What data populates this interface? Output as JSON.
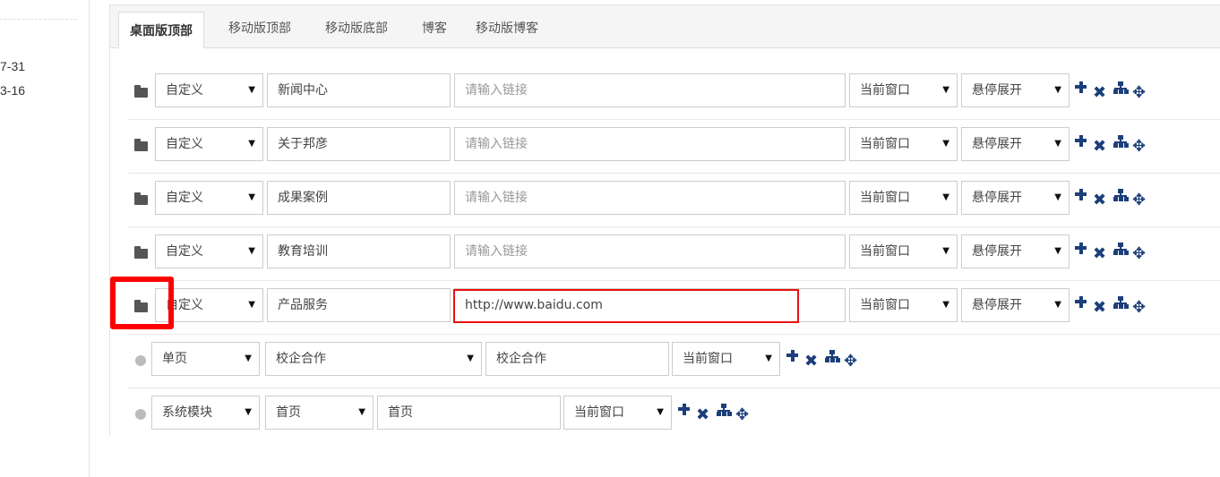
{
  "left_dates": [
    "7-31",
    "3-16"
  ],
  "tabs": [
    "桌面版顶部",
    "移动版顶部",
    "移动版底部",
    "博客",
    "移动版博客"
  ],
  "menu_rows": [
    {
      "type": "自定义",
      "name": "新闻中心",
      "link": "",
      "link_placeholder": "请输入链接",
      "target": "当前窗口",
      "display": "悬停展开"
    },
    {
      "type": "自定义",
      "name": "关于邦彦",
      "link": "",
      "link_placeholder": "请输入链接",
      "target": "当前窗口",
      "display": "悬停展开"
    },
    {
      "type": "自定义",
      "name": "成果案例",
      "link": "",
      "link_placeholder": "请输入链接",
      "target": "当前窗口",
      "display": "悬停展开"
    },
    {
      "type": "自定义",
      "name": "教育培训",
      "link": "",
      "link_placeholder": "请输入链接",
      "target": "当前窗口",
      "display": "悬停展开"
    },
    {
      "type": "自定义",
      "name": "产品服务",
      "link": "http://www.baidu.com",
      "link_placeholder": "请输入链接",
      "target": "当前窗口",
      "display": "悬停展开"
    }
  ],
  "page_rows": [
    {
      "type": "单页",
      "page": "校企合作",
      "name": "校企合作",
      "target": "当前窗口"
    },
    {
      "type": "系统模块",
      "page": "首页",
      "name": "首页",
      "target": "当前窗口"
    }
  ],
  "icons": {
    "folder": "folder-icon",
    "dot": "bullet-dot-icon",
    "add": "plus-icon",
    "delete": "times-icon",
    "children": "sitemap-icon",
    "move": "move-icon"
  },
  "colors": {
    "action_icon": "#1c3f7a",
    "highlight": "#ff0000"
  }
}
